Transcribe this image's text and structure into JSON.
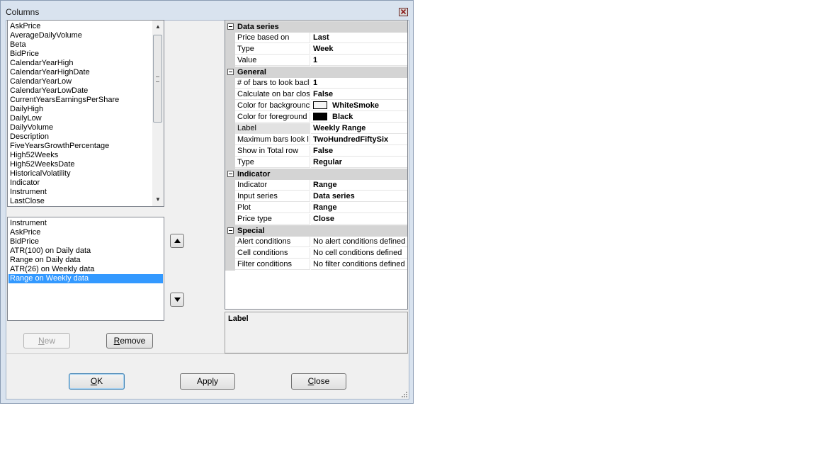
{
  "window": {
    "title": "Columns"
  },
  "available_list": {
    "items": [
      "AskPrice",
      "AverageDailyVolume",
      "Beta",
      "BidPrice",
      "CalendarYearHigh",
      "CalendarYearHighDate",
      "CalendarYearLow",
      "CalendarYearLowDate",
      "CurrentYearsEarningsPerShare",
      "DailyHigh",
      "DailyLow",
      "DailyVolume",
      "Description",
      "FiveYearsGrowthPercentage",
      "High52Weeks",
      "High52WeeksDate",
      "HistoricalVolatility",
      "Indicator",
      "Instrument",
      "LastClose"
    ]
  },
  "selected_list": {
    "items": [
      "Instrument",
      "AskPrice",
      "BidPrice",
      "ATR(100) on Daily data",
      "Range on Daily data",
      "ATR(26) on Weekly data",
      "Range on Weekly data"
    ],
    "selected_index": 6
  },
  "buttons": {
    "new": {
      "pre": "",
      "key": "N",
      "post": "ew"
    },
    "remove": {
      "pre": "",
      "key": "R",
      "post": "emove"
    },
    "ok": {
      "pre": "",
      "key": "O",
      "post": "K"
    },
    "apply": {
      "pre": "App",
      "key": "l",
      "post": "y"
    },
    "close": {
      "pre": "",
      "key": "C",
      "post": "lose"
    }
  },
  "property_grid": {
    "categories": [
      {
        "name": "Data series",
        "rows": [
          {
            "name": "Price based on",
            "value": "Last"
          },
          {
            "name": "Type",
            "value": "Week"
          },
          {
            "name": "Value",
            "value": "1"
          }
        ]
      },
      {
        "name": "General",
        "rows": [
          {
            "name": "# of bars to look bacl",
            "value": "1"
          },
          {
            "name": "Calculate on bar clos",
            "value": "False"
          },
          {
            "name": "Color for backgrounc",
            "value": "WhiteSmoke"
          },
          {
            "name": "Color for foreground",
            "value": "Black"
          },
          {
            "name": "Label",
            "value": "Weekly Range"
          },
          {
            "name": "Maximum bars look l",
            "value": "TwoHundredFiftySix"
          },
          {
            "name": "Show in Total row",
            "value": "False"
          },
          {
            "name": "Type",
            "value": "Regular"
          }
        ]
      },
      {
        "name": "Indicator",
        "rows": [
          {
            "name": "Indicator",
            "value": "Range"
          },
          {
            "name": "Input series",
            "value": "Data series"
          },
          {
            "name": "Plot",
            "value": "Range"
          },
          {
            "name": "Price type",
            "value": "Close"
          }
        ]
      },
      {
        "name": "Special",
        "rows": [
          {
            "name": "Alert conditions",
            "value": "No alert conditions defined"
          },
          {
            "name": "Cell conditions",
            "value": "No cell conditions defined"
          },
          {
            "name": "Filter conditions",
            "value": "No filter conditions defined"
          }
        ]
      }
    ],
    "selected_property": "Label",
    "swatch_colors": {
      "background": "#f5f5f5",
      "foreground": "#000000"
    }
  },
  "description": {
    "title": "Label"
  }
}
